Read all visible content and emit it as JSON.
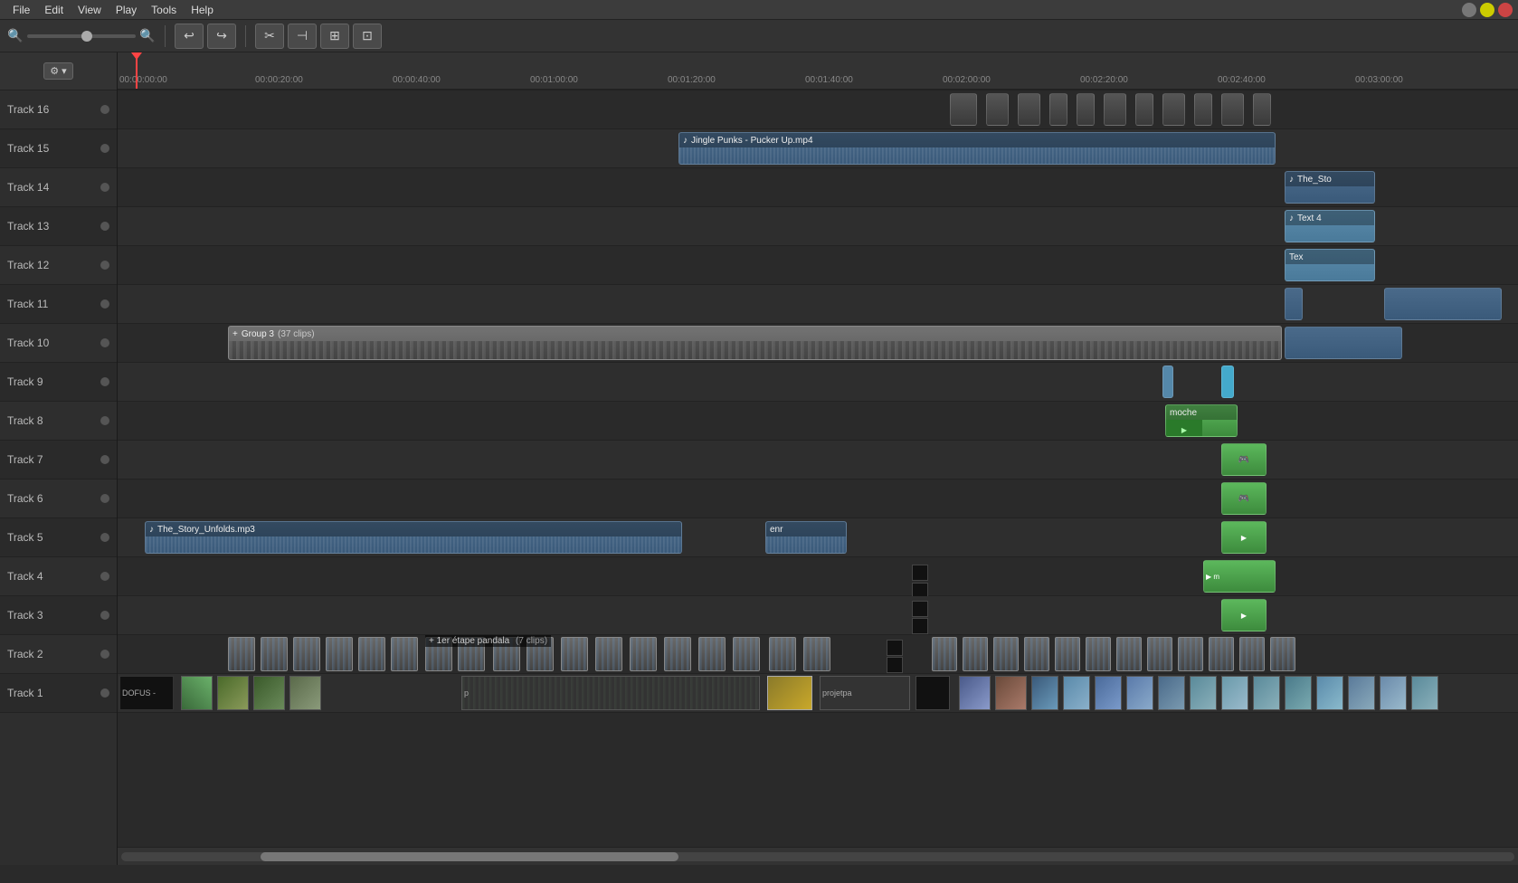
{
  "menubar": {
    "items": [
      "File",
      "Edit",
      "View",
      "Play",
      "Tools",
      "Help"
    ]
  },
  "toolbar": {
    "search_placeholder": "Search",
    "buttons": [
      "undo",
      "redo",
      "cut",
      "split",
      "add",
      "fit"
    ]
  },
  "ruler": {
    "marks": [
      "00:00:00:00",
      "00:00:20:00",
      "00:00:40:00",
      "00:01:00:00",
      "00:01:20:00",
      "00:01:40:00",
      "00:02:00:00",
      "00:02:20:00",
      "00:02:40:00",
      "00:03:00:00"
    ]
  },
  "tracks": [
    {
      "id": 1,
      "name": "Track 1"
    },
    {
      "id": 2,
      "name": "Track 2"
    },
    {
      "id": 3,
      "name": "Track 3"
    },
    {
      "id": 4,
      "name": "Track 4"
    },
    {
      "id": 5,
      "name": "Track 5"
    },
    {
      "id": 6,
      "name": "Track 6"
    },
    {
      "id": 7,
      "name": "Track 7"
    },
    {
      "id": 8,
      "name": "Track 8"
    },
    {
      "id": 9,
      "name": "Track 9"
    },
    {
      "id": 10,
      "name": "Track 10"
    },
    {
      "id": 11,
      "name": "Track 11"
    },
    {
      "id": 12,
      "name": "Track 12"
    },
    {
      "id": 13,
      "name": "Track 13"
    },
    {
      "id": 14,
      "name": "Track 14"
    },
    {
      "id": 15,
      "name": "Track 15"
    },
    {
      "id": 16,
      "name": "Track 16"
    }
  ],
  "clips": {
    "track16_label": "Track 16",
    "track15_clip": "Jingle Punks - Pucker Up.mp4",
    "track14_clip": "The_Sto",
    "track13_clip": "Text 4",
    "track12_clip": "Tex",
    "track10_group": "Group 3",
    "track10_group_count": "(37 clips)",
    "track8_clip": "moche",
    "track5_clip1": "The_Story_Unfolds.mp3",
    "track5_clip2": "enr",
    "track2_add_label": "+ 1er étape pandala",
    "track2_add_count": "(7 clips)",
    "track1_clip1": "DOFUS -",
    "track1_clip2": "p",
    "track1_clip3": "projetpa",
    "settings_label": "⚙ ▾"
  }
}
